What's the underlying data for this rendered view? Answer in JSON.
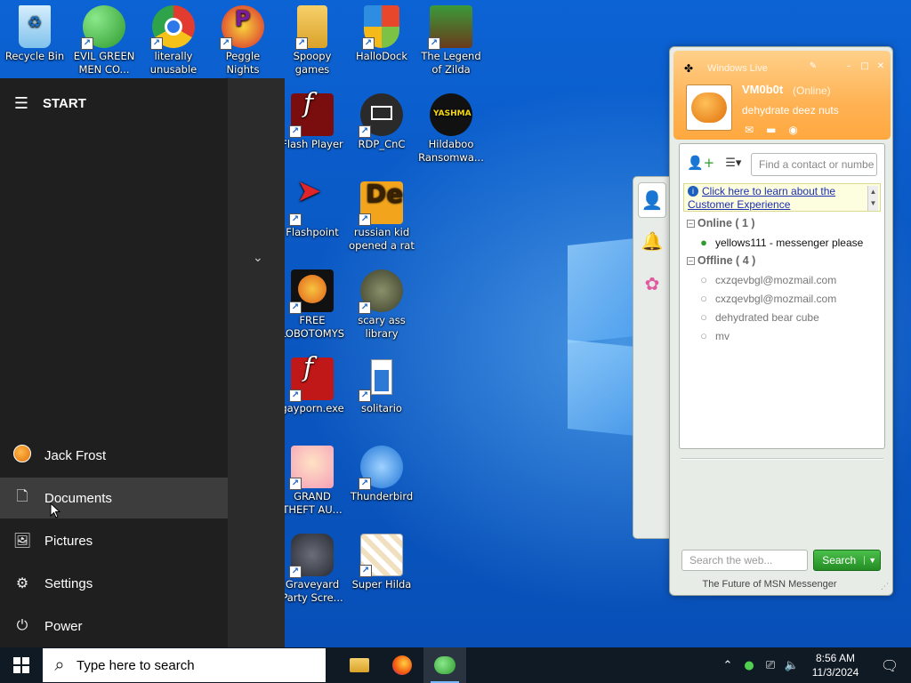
{
  "desktop": {
    "icons": [
      {
        "label": "Recycle Bin",
        "icon": "recycle-bin-icon",
        "color": "#9fd4f5"
      },
      {
        "label": "EVIL GREEN MEN CO...",
        "icon": "green-men-icon",
        "color": "#3fae3f"
      },
      {
        "label": "literally unusable",
        "icon": "chrome-icon",
        "color": "#e23b2f"
      },
      {
        "label": "Peggle Nights Deluxe",
        "icon": "peggle-icon",
        "color": "#d8262f"
      },
      {
        "label": "Spoopy games",
        "icon": "folder-icon",
        "color": "#f0c050"
      },
      {
        "label": "HalloDock",
        "icon": "shield-icon",
        "color": "#e04a2c"
      },
      {
        "label": "The Legend of Zilda",
        "icon": "zilda-icon",
        "color": "#3a9a3a"
      },
      {
        "label": "Flash Player",
        "icon": "flash-icon",
        "color": "#7a0d0d"
      },
      {
        "label": "RDP_CnC",
        "icon": "rdp-icon",
        "color": "#2a2a2a"
      },
      {
        "label": "Hildaboo Ransomwa...",
        "icon": "ransomware-icon",
        "color": "#111111"
      },
      {
        "label": "Flashpoint",
        "icon": "flashpoint-icon",
        "color": "#e0252a"
      },
      {
        "label": "russian kid opened a rat",
        "icon": "de-icon",
        "color": "#f2a51c"
      },
      {
        "label": "FREE LOBOTOMYS",
        "icon": "lobotomy-icon",
        "color": "#f08a1d"
      },
      {
        "label": "scary ass library",
        "icon": "library-icon",
        "color": "#4d5a2a"
      },
      {
        "label": "gayporn.exe",
        "icon": "flash-icon",
        "color": "#c01818"
      },
      {
        "label": "solitario",
        "icon": "solitaire-icon",
        "color": "#2c7ad6"
      },
      {
        "label": "GRAND THEFT AU...",
        "icon": "anime-girl-icon",
        "color": "#f5b3c4"
      },
      {
        "label": "Thunderbird",
        "icon": "thunderbird-icon",
        "color": "#1e74d6"
      },
      {
        "label": "Graveyard Party Scre...",
        "icon": "graveyard-icon",
        "color": "#3b3e4a"
      },
      {
        "label": "Super Hilda",
        "icon": "super-hilda-icon",
        "color": "#f2f2f2"
      }
    ]
  },
  "start_menu": {
    "header": "START",
    "user": "Jack Frost",
    "items": [
      {
        "label": "Documents",
        "icon": "document-icon"
      },
      {
        "label": "Pictures",
        "icon": "pictures-icon"
      },
      {
        "label": "Settings",
        "icon": "gear-icon"
      },
      {
        "label": "Power",
        "icon": "power-icon"
      }
    ]
  },
  "taskbar": {
    "search_placeholder": "Type here to search",
    "apps": [
      "file-explorer-icon",
      "firefox-icon",
      "messenger-icon"
    ],
    "clock_time": "8:56 AM",
    "clock_date": "11/3/2024"
  },
  "messenger": {
    "title": "Windows Live",
    "display_name": "VM0b0t",
    "status": "(Online)",
    "personal_message": "dehydrate deez nuts",
    "find_placeholder": "Find a contact or numbe",
    "info_text": "Click here to learn about the Customer Experience",
    "groups": [
      {
        "label": "Online ( 1 )",
        "contacts": [
          "yellows111 - messenger please"
        ]
      },
      {
        "label": "Offline ( 4 )",
        "contacts": [
          "cxzqevbgl@mozmail.com",
          "cxzqevbgl@mozmail.com",
          "dehydrated bear cube",
          "mv"
        ]
      }
    ],
    "web_search_placeholder": "Search the web...",
    "search_button": "Search",
    "footer": "The Future of MSN Messenger",
    "accent": "#ffb253"
  }
}
